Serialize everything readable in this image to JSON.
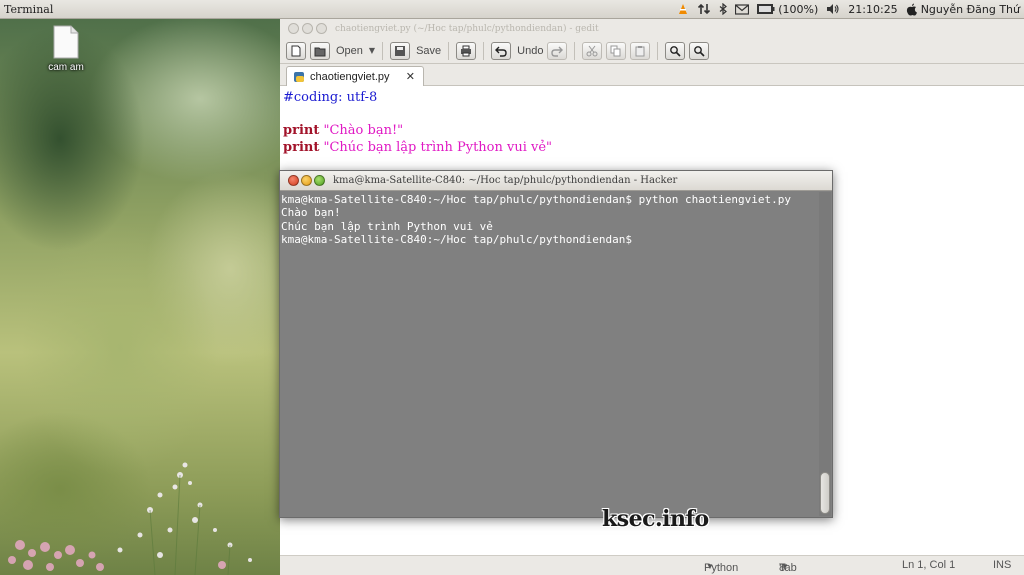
{
  "top_panel": {
    "app_name": "Terminal",
    "battery": "(100%)",
    "time": "21:10:25",
    "user": "Nguyễn Đăng Thứ",
    "icons": [
      "vlc-icon",
      "network-icon",
      "bluetooth-icon",
      "mail-icon",
      "battery-icon",
      "volume-icon",
      "apple-icon"
    ]
  },
  "desktop": {
    "icon_label": "cam am"
  },
  "gedit": {
    "title": "chaotiengviet.py (~/Hoc tap/phulc/pythondiendan) - gedit",
    "toolbar": {
      "open_label": "Open",
      "save_label": "Save",
      "undo_label": "Undo"
    },
    "tab_label": "chaotiengviet.py",
    "tab_close": "✕",
    "code": {
      "line1": "#coding: utf-8",
      "line3_kw": "print",
      "line3_str": "\"Chào bạn!\"",
      "line4_kw": "print",
      "line4_str": "\"Chúc bạn lập trình Python vui vẻ\""
    },
    "status": {
      "language": "Python",
      "tab_width": "Tab Width:",
      "tab_width_value": "8",
      "position": "Ln 1, Col 1",
      "mode": "INS"
    }
  },
  "terminal": {
    "title": "kma@kma-Satellite-C840: ~/Hoc tap/phulc/pythondiendan - Hacker",
    "lines": [
      "kma@kma-Satellite-C840:~/Hoc tap/phulc/pythondiendan$ python chaotiengviet.py",
      "Chào bạn!",
      "Chúc bạn lập trình Python vui vẻ",
      "kma@kma-Satellite-C840:~/Hoc tap/phulc/pythondiendan$ "
    ]
  },
  "watermark": "ksec.info",
  "colors": {
    "comment": "#1b1bd1",
    "keyword": "#a2132a",
    "string": "#e019c4",
    "terminal_bg": "#808080"
  }
}
